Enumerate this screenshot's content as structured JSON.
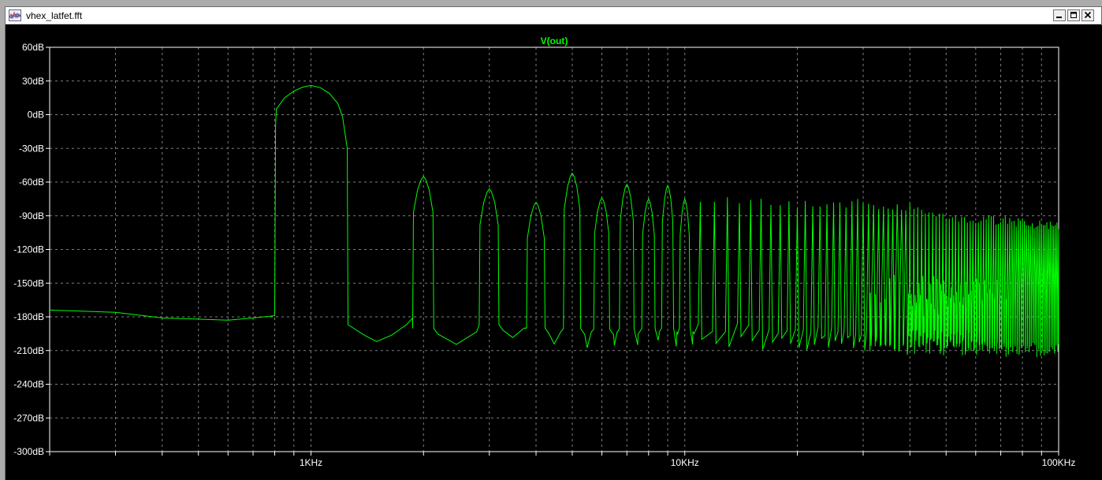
{
  "window": {
    "title": "vhex_latfet.fft",
    "title_icon": "waveform-file-icon",
    "controls": {
      "minimize_icon": "minimize-icon",
      "restore_icon": "restore-icon",
      "close_icon": "close-icon"
    }
  },
  "colors": {
    "background": "#000000",
    "trace": "#00ff00",
    "grid": "#7f7f7f",
    "axis_text": "#ffffff",
    "title_text": "#00ff00"
  },
  "chart_data": {
    "type": "line",
    "title": "V(out)",
    "xscale": "log",
    "xlim": [
      200,
      100000
    ],
    "ylim": [
      -300,
      60
    ],
    "ylabel": "",
    "xlabel": "",
    "grid": true,
    "x_tick_labels": [
      {
        "value": 1000,
        "label": "1KHz"
      },
      {
        "value": 10000,
        "label": "10KHz"
      },
      {
        "value": 100000,
        "label": "100KHz"
      }
    ],
    "y_tick_labels": [
      {
        "value": 60,
        "label": "60dB"
      },
      {
        "value": 30,
        "label": "30dB"
      },
      {
        "value": 0,
        "label": "0dB"
      },
      {
        "value": -30,
        "label": "-30dB"
      },
      {
        "value": -60,
        "label": "-60dB"
      },
      {
        "value": -90,
        "label": "-90dB"
      },
      {
        "value": -120,
        "label": "-120dB"
      },
      {
        "value": -150,
        "label": "-150dB"
      },
      {
        "value": -180,
        "label": "-180dB"
      },
      {
        "value": -210,
        "label": "-210dB"
      },
      {
        "value": -240,
        "label": "-240dB"
      },
      {
        "value": -270,
        "label": "-270dB"
      },
      {
        "value": -300,
        "label": "-300dB"
      }
    ],
    "series": [
      {
        "name": "V(out)",
        "noise_floor": [
          [
            200,
            -174
          ],
          [
            300,
            -176
          ],
          [
            400,
            -181
          ],
          [
            500,
            -182
          ],
          [
            600,
            -183
          ],
          [
            700,
            -181
          ],
          [
            800,
            -179
          ]
        ],
        "fundamental": {
          "freq": 1000,
          "peak": 26,
          "band_low": 800,
          "band_high": 1250
        },
        "harmonics": [
          {
            "n": 2,
            "freq": 2000,
            "peak": -55
          },
          {
            "n": 3,
            "freq": 3000,
            "peak": -66
          },
          {
            "n": 4,
            "freq": 4000,
            "peak": -78
          },
          {
            "n": 5,
            "freq": 5000,
            "peak": -52
          },
          {
            "n": 6,
            "freq": 6000,
            "peak": -74
          },
          {
            "n": 7,
            "freq": 7000,
            "peak": -62
          },
          {
            "n": 8,
            "freq": 8000,
            "peak": -75
          },
          {
            "n": 9,
            "freq": 9000,
            "peak": -63
          },
          {
            "n": 10,
            "freq": 10000,
            "peak": -75
          }
        ],
        "upper_harmonic_envelope": [
          [
            11000,
            -71
          ],
          [
            15000,
            -72
          ],
          [
            20000,
            -75
          ],
          [
            30000,
            -75
          ],
          [
            40000,
            -79
          ],
          [
            50000,
            -87
          ],
          [
            70000,
            -90
          ],
          [
            100000,
            -96
          ]
        ],
        "trough_envelope": [
          [
            1250,
            -187
          ],
          [
            1500,
            -202
          ],
          [
            2500,
            -190
          ],
          [
            4000,
            -195
          ],
          [
            6000,
            -196
          ],
          [
            10000,
            -195
          ],
          [
            20000,
            -197
          ],
          [
            40000,
            -200
          ],
          [
            100000,
            -203
          ]
        ]
      }
    ]
  }
}
